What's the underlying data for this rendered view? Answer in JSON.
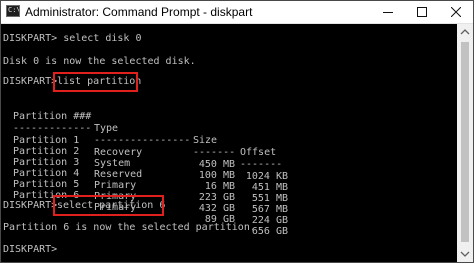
{
  "window": {
    "title": "Administrator: Command Prompt - diskpart",
    "icon_text": "C:\\"
  },
  "controls": {
    "minimize_icon": "minimize-icon",
    "maximize_icon": "maximize-icon",
    "close_icon": "close-icon"
  },
  "console": {
    "cmd1": "DISKPART> select disk 0",
    "out1": "Disk 0 is now the selected disk.",
    "prompt2": "DISKPART>",
    "cmd2": "list partition",
    "table": {
      "headers": [
        "Partition ###",
        "Type",
        "Size",
        "Offset"
      ],
      "separators": [
        "-------------",
        "----------------",
        "-------",
        "-------"
      ],
      "rows": [
        [
          "Partition 1",
          "Recovery",
          "450 MB",
          "1024 KB"
        ],
        [
          "Partition 2",
          "System",
          "100 MB",
          "451 MB"
        ],
        [
          "Partition 3",
          "Reserved",
          "16 MB",
          "551 MB"
        ],
        [
          "Partition 4",
          "Primary",
          "223 GB",
          "567 MB"
        ],
        [
          "Partition 5",
          "Primary",
          "432 GB",
          "224 GB"
        ],
        [
          "Partition 6",
          "Primary",
          "89 GB",
          "656 GB"
        ]
      ]
    },
    "prompt3": "DISKPART>",
    "cmd3": "select partition 6",
    "out3": "Partition 6 is now the selected partition.",
    "prompt4": "DISKPART>"
  },
  "colors": {
    "console_bg": "#000000",
    "console_text": "#c0c0c0",
    "highlight": "#e0201c",
    "titlebar_bg": "#ffffff"
  }
}
